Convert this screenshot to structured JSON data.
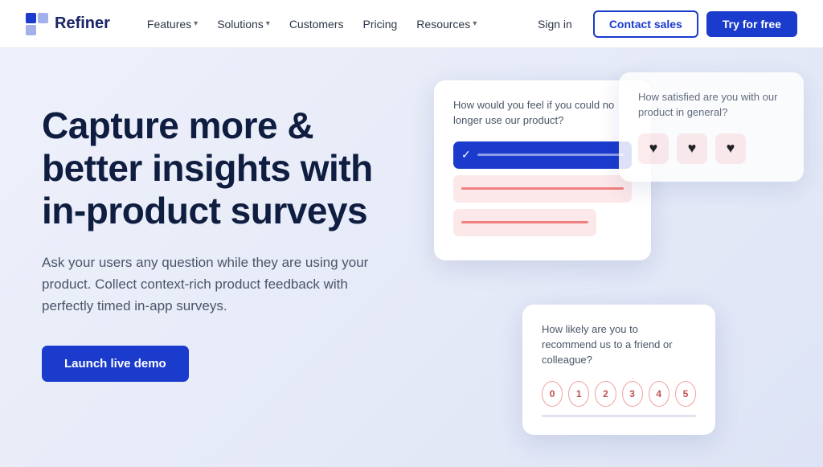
{
  "nav": {
    "logo_text": "Refiner",
    "features_label": "Features",
    "solutions_label": "Solutions",
    "customers_label": "Customers",
    "pricing_label": "Pricing",
    "resources_label": "Resources",
    "signin_label": "Sign in",
    "contact_label": "Contact sales",
    "try_label": "Try for free"
  },
  "hero": {
    "headline": "Capture more & better insights with in-product surveys",
    "subtext": "Ask your users any question while they are using your product. Collect context-rich product feedback with perfectly timed in-app surveys.",
    "cta_label": "Launch live demo"
  },
  "survey_card_1": {
    "question": "How would you feel if you could no longer use our product?"
  },
  "survey_card_2": {
    "question": "How satisfied are you with our product in general?"
  },
  "survey_card_3": {
    "question": "How likely are you to recommend us to a friend or colleague?"
  },
  "nps_numbers": [
    "0",
    "1",
    "2",
    "3",
    "4",
    "5"
  ]
}
